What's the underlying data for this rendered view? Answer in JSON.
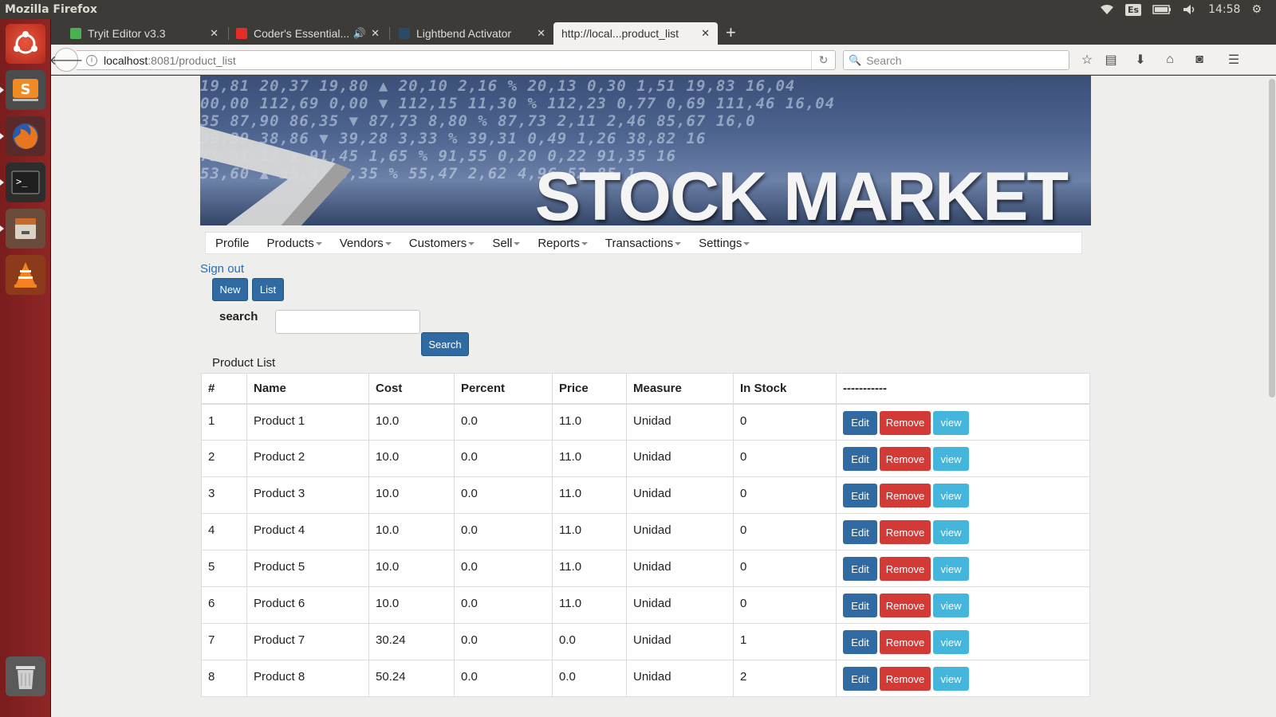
{
  "os": {
    "app_title": "Mozilla Firefox",
    "keyboard_layout": "Es",
    "clock": "14:58"
  },
  "browser": {
    "tabs": [
      {
        "label": "Tryit Editor v3.3",
        "fav_color": "#4caf50"
      },
      {
        "label": "Coder's Essential...",
        "fav_color": "#e52d27"
      },
      {
        "label": "Lightbend Activator",
        "fav_color": "#2b4a66"
      },
      {
        "label": "http://local...product_list",
        "fav_color": ""
      }
    ],
    "url_host": "localhost",
    "url_rest": ":8081/product_list",
    "search_placeholder": "Search"
  },
  "banner": {
    "title": "STOCK MARKET",
    "ticker_lines": [
      "19,81  20,37 19,80  ▲  20,10   2,16 %   20,13 0,30 1,51   19,83 16,04",
      "00,00  112,69  0,00  ▼  112,15  11,30 %  112,23 0,77 0,69 111,46 16,04",
      "35  87,90 86,35  ▼  87,73   8,80 %   87,73 2,11 2,46   85,67 16,0",
      "39,39 38,86   ▼  39,28   3,33 %   39,31 0,49 1,26   38,82 16",
      "75 91,19  ▲  91,45   1,65 %   91,55 0,20 0,22   91,35 16",
      "53,60  ▲  55,41   0,35 %   55,47 2,62 4,96   52,85 1"
    ]
  },
  "menu": [
    {
      "label": "Profile",
      "dropdown": false
    },
    {
      "label": "Products",
      "dropdown": true
    },
    {
      "label": "Vendors",
      "dropdown": true
    },
    {
      "label": "Customers",
      "dropdown": true
    },
    {
      "label": "Sell",
      "dropdown": true
    },
    {
      "label": "Reports",
      "dropdown": true
    },
    {
      "label": "Transactions",
      "dropdown": true
    },
    {
      "label": "Settings",
      "dropdown": true
    }
  ],
  "page": {
    "signout": "Sign out",
    "new_label": "New",
    "list_label": "List",
    "search_label": "search",
    "search_button": "Search",
    "list_title": "Product List"
  },
  "table": {
    "headers": [
      "#",
      "Name",
      "Cost",
      "Percent",
      "Price",
      "Measure",
      "In Stock",
      "-----------"
    ],
    "action_labels": {
      "edit": "Edit",
      "remove": "Remove",
      "view": "view"
    },
    "rows": [
      [
        "1",
        "Product 1",
        "10.0",
        "0.0",
        "11.0",
        "Unidad",
        "0"
      ],
      [
        "2",
        "Product 2",
        "10.0",
        "0.0",
        "11.0",
        "Unidad",
        "0"
      ],
      [
        "3",
        "Product 3",
        "10.0",
        "0.0",
        "11.0",
        "Unidad",
        "0"
      ],
      [
        "4",
        "Product 4",
        "10.0",
        "0.0",
        "11.0",
        "Unidad",
        "0"
      ],
      [
        "5",
        "Product 5",
        "10.0",
        "0.0",
        "11.0",
        "Unidad",
        "0"
      ],
      [
        "6",
        "Product 6",
        "10.0",
        "0.0",
        "11.0",
        "Unidad",
        "0"
      ],
      [
        "7",
        "Product 7",
        "30.24",
        "0.0",
        "0.0",
        "Unidad",
        "1"
      ],
      [
        "8",
        "Product 8",
        "50.24",
        "0.0",
        "0.0",
        "Unidad",
        "2"
      ]
    ]
  },
  "colors": {
    "primary": "#2f6aa3",
    "danger": "#d33a35",
    "info": "#44b6dc",
    "link": "#2a6cb5"
  }
}
